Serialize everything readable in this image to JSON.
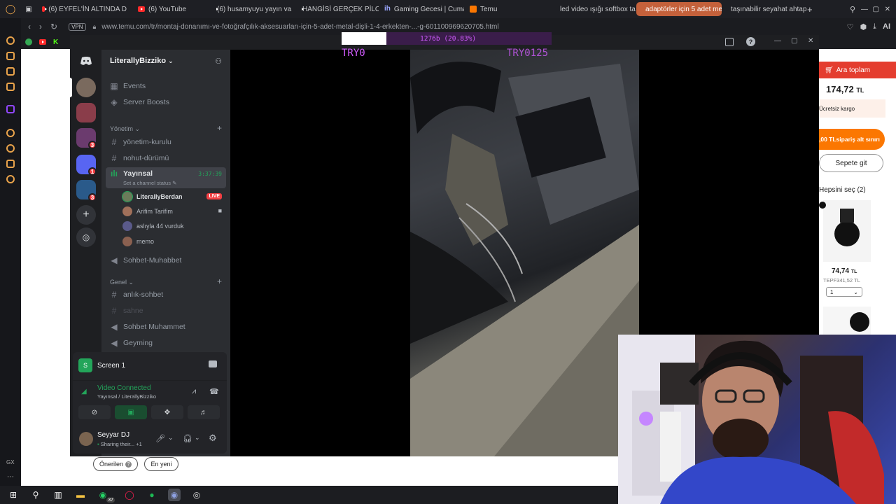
{
  "browser": {
    "tabs": [
      {
        "label": "(6) EYFEL'İN ALTINDA D",
        "icon": "youtube-icon"
      },
      {
        "label": "(6) YouTube",
        "icon": "youtube-icon"
      },
      {
        "label": "(6) husamyuyu yayın va",
        "icon": "youtube-icon"
      },
      {
        "label": "HANGİSİ GERÇEK PİLOT",
        "icon": "youtube-icon"
      },
      {
        "label": "Gaming Gecesi | Cuma G",
        "icon": "ih-icon"
      },
      {
        "label": "Temu",
        "icon": "temu-icon"
      },
      {
        "label": "led video ışığı softbox ta",
        "icon": "temu-icon"
      },
      {
        "label": "adaptörler için 5 adet met",
        "icon": "temu-icon",
        "active": true
      },
      {
        "label": "taşınabilir seyahat ahtap",
        "icon": "temu-icon"
      }
    ],
    "vpn_label": "VPN",
    "url": "www.temu.com/tr/montaj-donanımı-ve-fotoğrafçılık-aksesuarları-için-5-adet-metal-dişli-1-4-erkekten-...-g-601100969620705.html",
    "ai_label": "AI"
  },
  "temu": {
    "subtotal_label": "Ara toplam",
    "subtotal_value": "174,72",
    "currency": "TL",
    "free_shipping": "Ücretsiz kargo",
    "order_min": ",00 TLsipariş alt sınırı",
    "checkout_button": "Sepete git",
    "select_all": "Hepsini seç (2)",
    "item_price": "74,74",
    "item_old_price": "TEPF341,52 TL",
    "qty_value": "1",
    "sort_recommended": "Önerilen",
    "sort_newest": "En yeni"
  },
  "discord": {
    "server_name": "LiterallyBizziko",
    "top_items": [
      {
        "label": "Events",
        "icon": "calendar-icon"
      },
      {
        "label": "Server Boosts",
        "icon": "boost-icon"
      }
    ],
    "categories": [
      {
        "label": "Yönetim"
      },
      {
        "label": "Genel"
      }
    ],
    "channels_group1": [
      {
        "label": "yönetim-kurulu",
        "icon": "hash-icon"
      },
      {
        "label": "nohut-dürümü",
        "icon": "hash-icon"
      }
    ],
    "voice_active": {
      "label": "Yayınsal",
      "timer": "3:37:39",
      "status": "Set a channel status",
      "users": [
        {
          "name": "LiterallyBerdan",
          "badge": "LIVE"
        },
        {
          "name": "Arifim Tarifim",
          "badge": ""
        },
        {
          "name": "aslıyla 44 vurduk",
          "badge": ""
        },
        {
          "name": "memo",
          "badge": ""
        }
      ]
    },
    "voice_other": {
      "label": "Sohbet-Muhabbet"
    },
    "channels_group2": [
      {
        "label": "anlık-sohbet",
        "icon": "hash-icon"
      },
      {
        "label": "sahne",
        "icon": "hash-icon"
      },
      {
        "label": "Sohbet Muhammet",
        "icon": "speaker-icon"
      },
      {
        "label": "Geyming",
        "icon": "speaker-icon"
      }
    ],
    "guild_badges": [
      "3",
      "1",
      "3"
    ],
    "screen_share": {
      "label": "Screen 1"
    },
    "connection": {
      "status": "Video Connected",
      "channel": "Yayınsal / LiterallyBizziko"
    },
    "user": {
      "name": "Seyyar DJ",
      "status": "Sharing their...",
      "extra": "+1"
    }
  },
  "stream_overlay": {
    "progress": "1276b (20.83%)",
    "progress_fraction": 0.2083,
    "left_tag": "TRY0",
    "right_tag": "TRY0125"
  },
  "taskbar": {
    "whatsapp_badge": "37"
  },
  "colors": {
    "discord_bg": "#1e1f22",
    "discord_sidebar": "#2b2d31",
    "discord_green": "#23a55a",
    "live_red": "#f23f43",
    "temu_orange": "#fb7701",
    "overlay_purple": "#d25cff"
  }
}
